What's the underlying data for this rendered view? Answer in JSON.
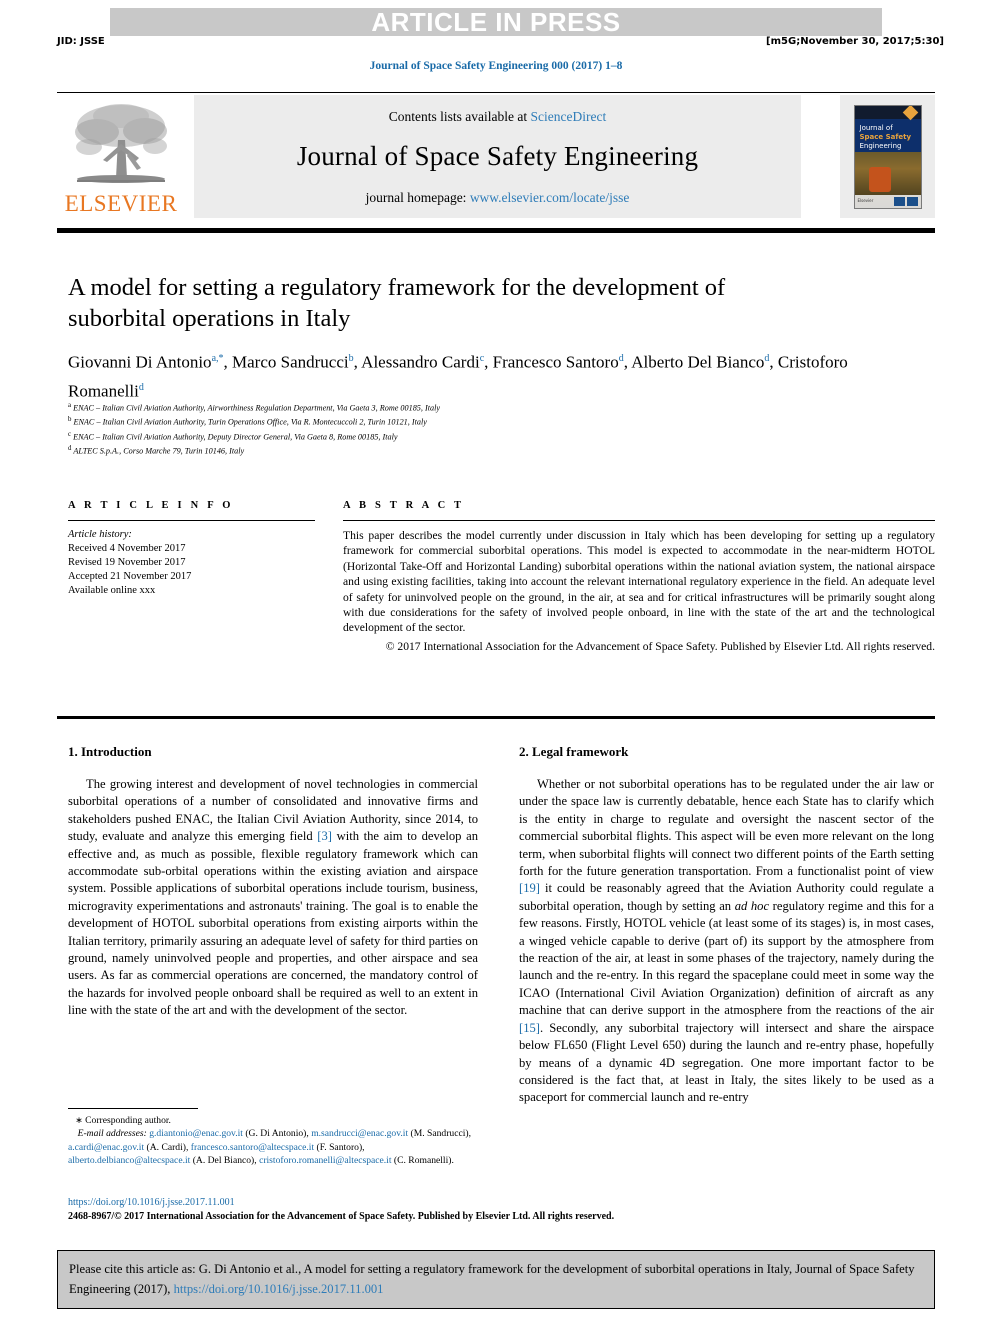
{
  "header": {
    "press_banner": "ARTICLE IN PRESS",
    "jid": "JID: JSSE",
    "build_stamp": "[m5G;November 30, 2017;5:30]",
    "journal_running_head": "Journal of Space Safety Engineering 000 (2017) 1–8"
  },
  "masthead": {
    "publisher_name": "ELSEVIER",
    "contents_prefix": "Contents lists available at ",
    "contents_link": "ScienceDirect",
    "journal_title": "Journal of Space Safety Engineering",
    "homepage_prefix": "journal homepage: ",
    "homepage_url": "www.elsevier.com/locate/jsse",
    "cover": {
      "line1": "Journal of",
      "line2": "Space Safety",
      "line3": "Engineering",
      "footer_left": "Elsevier"
    }
  },
  "article": {
    "title": "A model for setting a regulatory framework for the development of suborbital operations in Italy",
    "authors": [
      {
        "name": "Giovanni Di Antonio",
        "sup": "a,*"
      },
      {
        "name": "Marco Sandrucci",
        "sup": "b"
      },
      {
        "name": "Alessandro Cardi",
        "sup": "c"
      },
      {
        "name": "Francesco Santoro",
        "sup": "d"
      },
      {
        "name": "Alberto Del Bianco",
        "sup": "d"
      },
      {
        "name": "Cristoforo Romanelli",
        "sup": "d"
      }
    ],
    "affiliations": [
      {
        "label": "a",
        "text": "ENAC – Italian Civil Aviation Authority, Airworthiness Regulation Department, Via Gaeta 3, Rome 00185, Italy"
      },
      {
        "label": "b",
        "text": "ENAC – Italian Civil Aviation Authority, Turin Operations Office, Via R. Montecuccoli 2, Turin 10121, Italy"
      },
      {
        "label": "c",
        "text": "ENAC – Italian Civil Aviation Authority, Deputy Director General, Via Gaeta 8, Rome 00185, Italy"
      },
      {
        "label": "d",
        "text": "ALTEC S.p.A., Corso Marche 79, Turin 10146, Italy"
      }
    ]
  },
  "article_info": {
    "heading": "A R T I C L E   I N F O",
    "history_label": "Article history:",
    "history": [
      "Received 4 November 2017",
      "Revised 19 November 2017",
      "Accepted 21 November 2017",
      "Available online xxx"
    ]
  },
  "abstract": {
    "heading": "A B S T R A C T",
    "body": "This paper describes the model currently under discussion in Italy which has been developing for setting up a regulatory framework for commercial suborbital operations. This model is expected to accommodate in the near-midterm HOTOL (Horizontal Take-Off and Horizontal Landing) suborbital operations within the national aviation system, the national airspace and using existing facilities, taking into account the relevant international regulatory experience in the field. An adequate level of safety for uninvolved people on the ground, in the air, at sea and for critical infrastructures will be primarily sought along with due considerations for the safety of involved people onboard, in line with the state of the art and the technological development of the sector.",
    "copyright": "© 2017 International Association for the Advancement of Space Safety. Published by Elsevier Ltd. All rights reserved."
  },
  "sections": {
    "intro": {
      "heading": "1. Introduction",
      "p1_a": "The growing interest and development of novel technologies in commercial suborbital operations of a number of consolidated and innovative firms and stakeholders pushed ENAC, the Italian Civil Aviation Authority, since 2014, to study, evaluate and analyze this emerging field ",
      "p1_ref": "[3]",
      "p1_b": " with the aim to develop an effective and, as much as possible, flexible regulatory framework which can accommodate sub-orbital operations within the existing aviation and airspace system. Possible applications of suborbital operations include tourism, business, microgravity experimentations and astronauts' training. The goal is to enable the development of HOTOL suborbital operations from existing airports within the Italian territory, primarily assuring an adequate level of safety for third parties on ground, namely uninvolved people and properties, and other airspace and sea users. As far as commercial operations are concerned, the mandatory control of the hazards for involved people onboard shall be required as well to an extent in line with the state of the art and with the development of the sector."
    },
    "legal": {
      "heading": "2. Legal framework",
      "p1_a": "Whether or not suborbital operations has to be regulated under the air law or under the space law is currently debatable, hence each State has to clarify which is the entity in charge to regulate and oversight the nascent sector of the commercial suborbital flights. This aspect will be even more relevant on the long term, when suborbital flights will connect two different points of the Earth setting forth for the future generation transportation. From a functionalist point of view ",
      "p1_ref1": "[19]",
      "p1_b": " it could be reasonably agreed that the Aviation Authority could regulate a suborbital operation, though by setting an ",
      "p1_italic": "ad hoc",
      "p1_c": " regulatory regime and this for a few reasons. Firstly, HOTOL vehicle (at least some of its stages) is, in most cases, a winged vehicle capable to derive (part of) its support by the atmosphere from the reaction of the air, at least in some phases of the trajectory, namely during the launch and the re-entry. In this regard the spaceplane could meet in some way the ICAO (International Civil Aviation Organization) definition of aircraft as any machine that can derive support in the atmosphere from the reactions of the air ",
      "p1_ref2": "[15]",
      "p1_d": ". Secondly, any suborbital trajectory will intersect and share the airspace below FL650 (Flight Level 650) during the launch and re-entry phase, hopefully by means of a dynamic 4D segregation. One more important factor to be considered is the fact that, at least in Italy, the sites likely to be used as a spaceport for commercial launch and re-entry"
    }
  },
  "footnote": {
    "corresponding": "Corresponding author.",
    "email_label": "E-mail addresses:",
    "emails": [
      {
        "address": "g.diantonio@enac.gov.it",
        "person": " (G. Di Antonio), "
      },
      {
        "address": "m.sandrucci@enac.gov.it",
        "person": " (M. Sandrucci), "
      },
      {
        "address": "a.cardi@enac.gov.it",
        "person": " (A. Cardi), "
      },
      {
        "address": "francesco.santoro@altecspace.it",
        "person": " (F. Santoro), "
      },
      {
        "address": "alberto.delbianco@altecspace.it",
        "person": " (A. Del Bianco), "
      },
      {
        "address": "cristoforo.romanelli@altecspace.it",
        "person": " (C. Romanelli)."
      }
    ]
  },
  "publication": {
    "doi": "https://doi.org/10.1016/j.jsse.2017.11.001",
    "issn_line": "2468-8967/© 2017 International Association for the Advancement of Space Safety. Published by Elsevier Ltd. All rights reserved."
  },
  "citation": {
    "text": "Please cite this article as: G. Di Antonio et al., A model for setting a regulatory framework for the development of suborbital operations in Italy, Journal of Space Safety Engineering (2017), ",
    "doi": "https://doi.org/10.1016/j.jsse.2017.11.001"
  },
  "colors": {
    "link": "#1a6ba8",
    "elsevier_orange": "#e87722",
    "banner_gray": "#c8c8c8",
    "masthead_gray": "#ececec"
  }
}
